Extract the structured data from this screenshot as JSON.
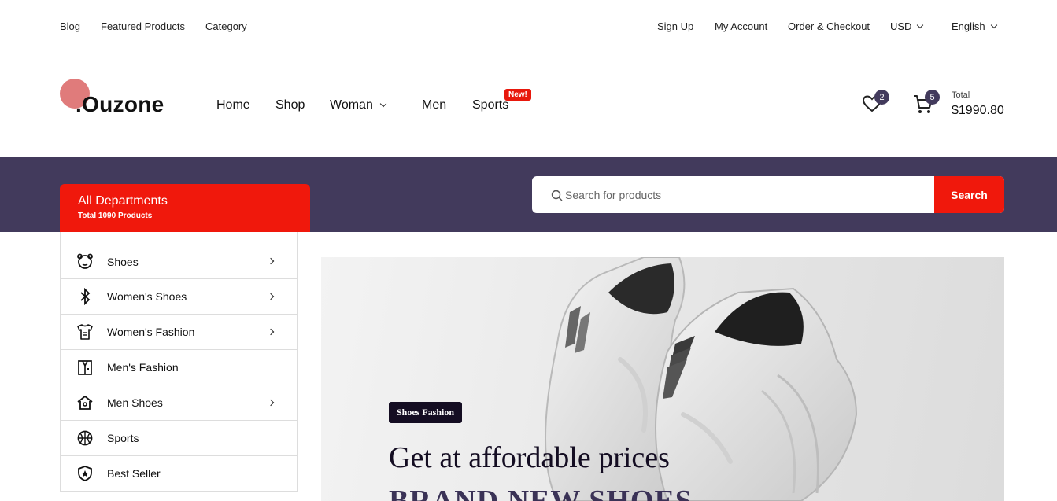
{
  "topbar": {
    "left_links": [
      "Blog",
      "Featured Products",
      "Category"
    ],
    "right_links": [
      "Sign Up",
      "My Account",
      "Order & Checkout"
    ],
    "currency": "USD",
    "language": "English"
  },
  "header": {
    "logo": ".Ouzone",
    "nav": [
      "Home",
      "Shop",
      "Woman",
      "Men",
      "Sports"
    ],
    "new_badge": "New!",
    "wishlist_count": "2",
    "cart_count": "5",
    "total_label": "Total",
    "total_value": "$1990.80"
  },
  "departments": {
    "title": "All Departments",
    "subtitle": "Total 1090 Products",
    "items": [
      {
        "label": "Shoes",
        "icon": "bear-face-icon",
        "arrow": true
      },
      {
        "label": "Women's Shoes",
        "icon": "bluetooth-icon",
        "arrow": true
      },
      {
        "label": "Women's Fashion",
        "icon": "shirt-icon",
        "arrow": true
      },
      {
        "label": "Men's Fashion",
        "icon": "jacket-icon",
        "arrow": false
      },
      {
        "label": "Men Shoes",
        "icon": "home-icon",
        "arrow": true
      },
      {
        "label": "Sports",
        "icon": "basketball-icon",
        "arrow": false
      },
      {
        "label": "Best Seller",
        "icon": "shield-star-icon",
        "arrow": false
      }
    ]
  },
  "search": {
    "placeholder": "Search for products",
    "button": "Search"
  },
  "hero": {
    "tag": "Shoes Fashion",
    "title": "Get at affordable prices",
    "title2": "BRAND NEW SHOES"
  },
  "colors": {
    "accent": "#f0180c",
    "band": "#423a5c",
    "logo_dot": "#e07b7b"
  }
}
